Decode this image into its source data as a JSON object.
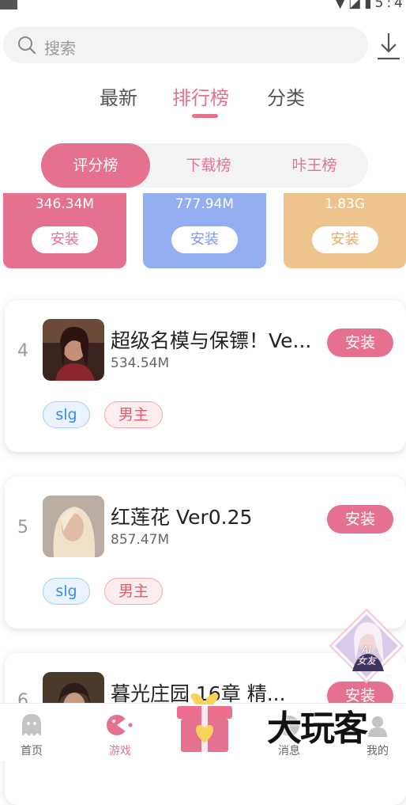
{
  "status_bar": {
    "time": "5:4"
  },
  "search": {
    "placeholder": "搜索"
  },
  "top_tabs": [
    {
      "label": "最新",
      "active": false
    },
    {
      "label": "排行榜",
      "active": true
    },
    {
      "label": "分类",
      "active": false
    }
  ],
  "segments": [
    {
      "label": "评分榜",
      "active": true
    },
    {
      "label": "下载榜",
      "active": false
    },
    {
      "label": "咔王榜",
      "active": false
    }
  ],
  "top_cards": [
    {
      "size": "346.34M",
      "button": "安装",
      "color": "#e5718f"
    },
    {
      "size": "777.94M",
      "button": "安装",
      "color": "#93aef0"
    },
    {
      "size": "1.83G",
      "button": "安装",
      "color": "#edc48d"
    }
  ],
  "list": [
    {
      "rank": "4",
      "title": "超级名模与保镖！Ve...",
      "size": "534.54M",
      "button": "安装",
      "tags": [
        "slg",
        "男主"
      ]
    },
    {
      "rank": "5",
      "title": "红莲花 Ver0.25",
      "size": "857.47M",
      "button": "安装",
      "tags": [
        "slg",
        "男主"
      ]
    },
    {
      "rank": "6",
      "title": "暮光庄园 16章 精...",
      "size": "",
      "button": "安装",
      "tags": []
    }
  ],
  "ai_badge": {
    "line1": "AI",
    "line2": "女友"
  },
  "bottom_nav": [
    {
      "label": "首页",
      "icon": "ghost-icon",
      "active": false
    },
    {
      "label": "游戏",
      "icon": "gamepad-icon",
      "active": true
    },
    {
      "label": "",
      "icon": "gift-icon",
      "active": false
    },
    {
      "label": "消息",
      "icon": "message-icon",
      "active": false
    },
    {
      "label": "我的",
      "icon": "user-icon",
      "active": false
    }
  ],
  "watermark": "大玩客",
  "colors": {
    "accent": "#e5718f",
    "blue_tag": "#3c8be0",
    "red_tag": "#e25b6d"
  }
}
